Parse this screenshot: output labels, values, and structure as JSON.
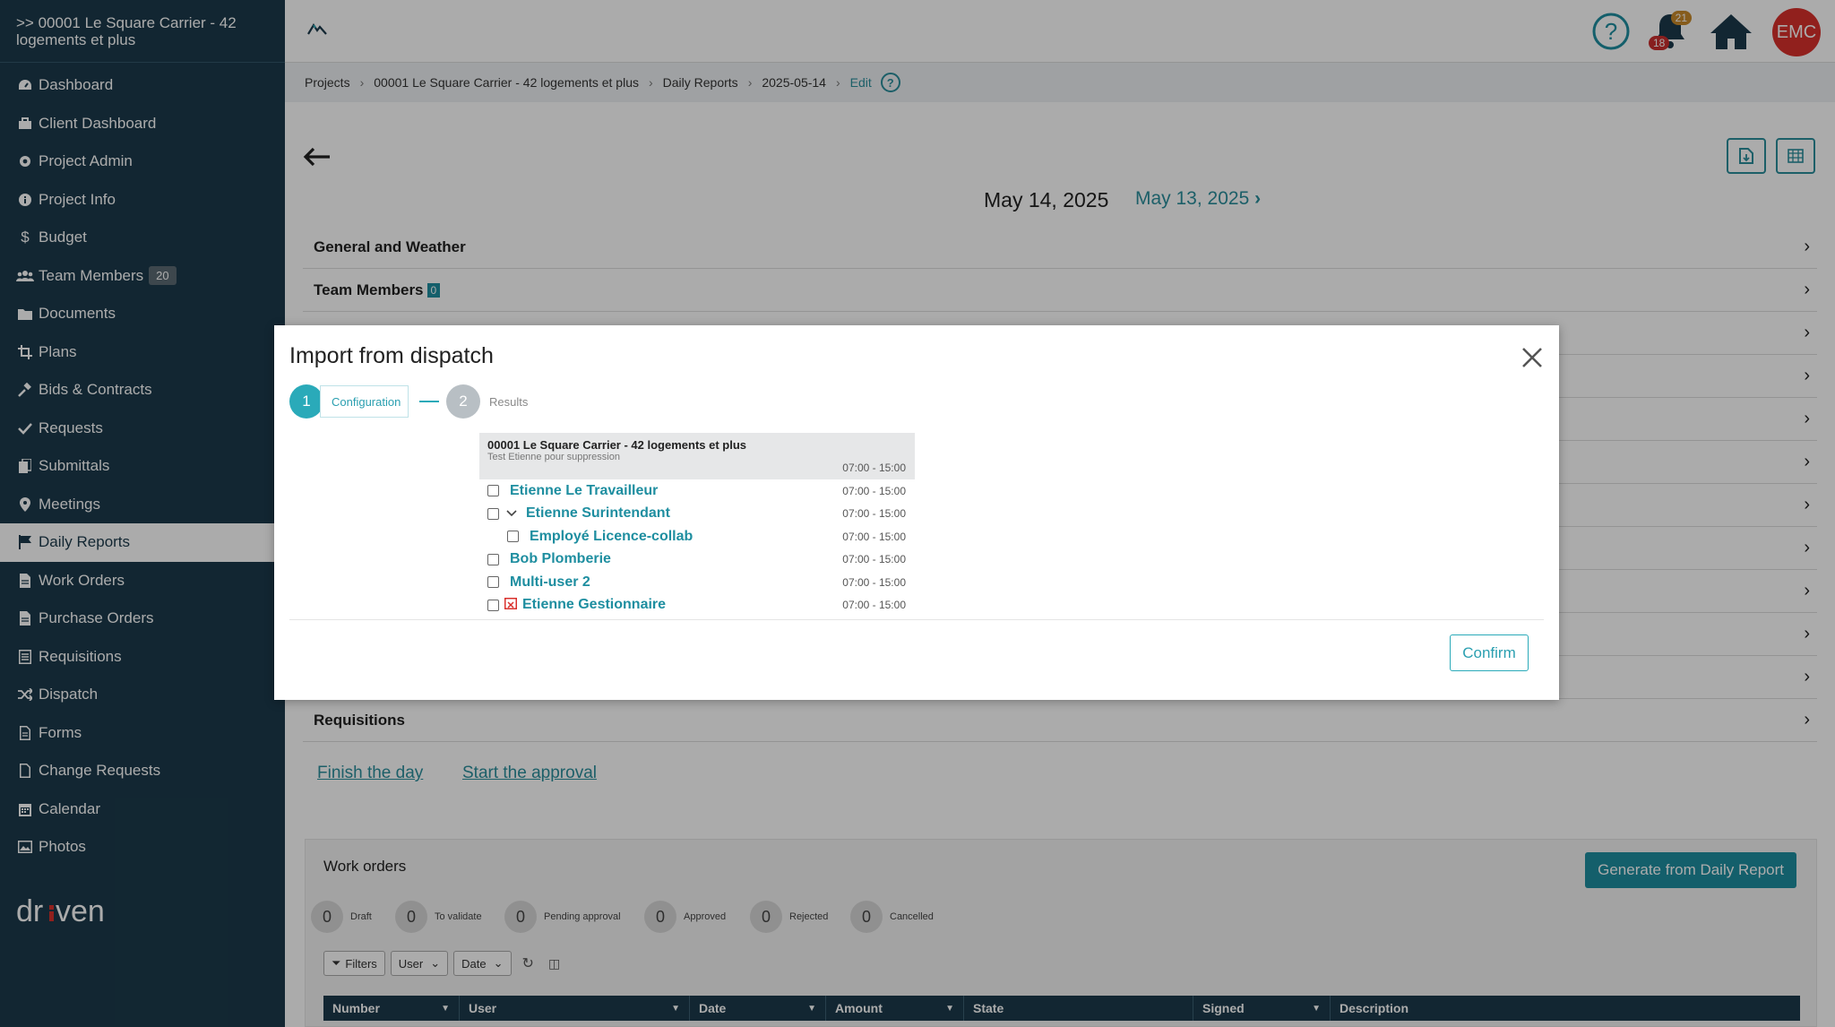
{
  "sidebar": {
    "project": ">> 00001 Le Square Carrier - 42 logements et plus",
    "items": [
      {
        "label": "Dashboard",
        "icon": "dashboard-icon"
      },
      {
        "label": "Client Dashboard",
        "icon": "briefcase-icon"
      },
      {
        "label": "Project Admin",
        "icon": "gear-icon"
      },
      {
        "label": "Project Info",
        "icon": "info-icon"
      },
      {
        "label": "Budget",
        "icon": "dollar-icon"
      },
      {
        "label": "Team Members",
        "icon": "users-icon",
        "badge": "20"
      },
      {
        "label": "Documents",
        "icon": "folder-icon"
      },
      {
        "label": "Plans",
        "icon": "crop-icon"
      },
      {
        "label": "Bids & Contracts",
        "icon": "gavel-icon"
      },
      {
        "label": "Requests",
        "icon": "check-icon"
      },
      {
        "label": "Submittals",
        "icon": "copy-icon"
      },
      {
        "label": "Meetings",
        "icon": "map-pin-icon"
      },
      {
        "label": "Daily Reports",
        "icon": "flag-icon"
      },
      {
        "label": "Work Orders",
        "icon": "file-icon"
      },
      {
        "label": "Purchase Orders",
        "icon": "file-icon"
      },
      {
        "label": "Requisitions",
        "icon": "list-icon"
      },
      {
        "label": "Dispatch",
        "icon": "shuffle-icon"
      },
      {
        "label": "Forms",
        "icon": "file-text-icon"
      },
      {
        "label": "Change Requests",
        "icon": "file-outline-icon"
      },
      {
        "label": "Calendar",
        "icon": "calendar-icon"
      },
      {
        "label": "Photos",
        "icon": "image-icon"
      }
    ],
    "logo": "dr ven"
  },
  "topbar": {
    "help": "?",
    "notif_count_orange": "21",
    "notif_count_red": "18",
    "avatar": "EMC"
  },
  "breadcrumb": {
    "items": [
      "Projects",
      "00001 Le Square Carrier - 42 logements et plus",
      "Daily Reports",
      "2025-05-14"
    ],
    "edit": "Edit",
    "help": "?"
  },
  "main": {
    "date_current": "May 14, 2025",
    "date_prev": "May 13, 2025",
    "sections": [
      {
        "label": "General and Weather"
      },
      {
        "label": "Team Members",
        "badge": "0"
      },
      {
        "label": "Requisitions"
      }
    ],
    "finish_link": "Finish the day",
    "approval_link": "Start the approval"
  },
  "work_orders": {
    "title": "Work orders",
    "generate_button": "Generate from Daily Report",
    "counters": [
      {
        "n": "0",
        "label": "Draft"
      },
      {
        "n": "0",
        "label": "To validate"
      },
      {
        "n": "0",
        "label": "Pending approval"
      },
      {
        "n": "0",
        "label": "Approved"
      },
      {
        "n": "0",
        "label": "Rejected"
      },
      {
        "n": "0",
        "label": "Cancelled"
      }
    ],
    "tools": {
      "filters": "Filters",
      "user": "User",
      "date": "Date"
    },
    "columns": [
      "Number",
      "User",
      "Date",
      "Amount",
      "State",
      "Signed",
      "Description"
    ]
  },
  "modal": {
    "title": "Import from dispatch",
    "step1_num": "1",
    "step1_label": "Configuration",
    "step2_num": "2",
    "step2_label": "Results",
    "dispatch": {
      "project": "00001 Le Square Carrier - 42 logements et plus",
      "subtitle": "Test Etienne pour suppression",
      "time": "07:00 - 15:00",
      "rows": [
        {
          "name": "Etienne Le Travailleur",
          "time": "07:00 - 15:00"
        },
        {
          "name": "Etienne Surintendant",
          "time": "07:00 - 15:00"
        },
        {
          "name": "Employé Licence-collab",
          "time": "07:00 - 15:00"
        },
        {
          "name": "Bob Plomberie",
          "time": "07:00 - 15:00"
        },
        {
          "name": "Multi-user 2",
          "time": "07:00 - 15:00"
        },
        {
          "name": "Etienne Gestionnaire",
          "time": "07:00 - 15:00"
        }
      ]
    },
    "confirm": "Confirm"
  }
}
